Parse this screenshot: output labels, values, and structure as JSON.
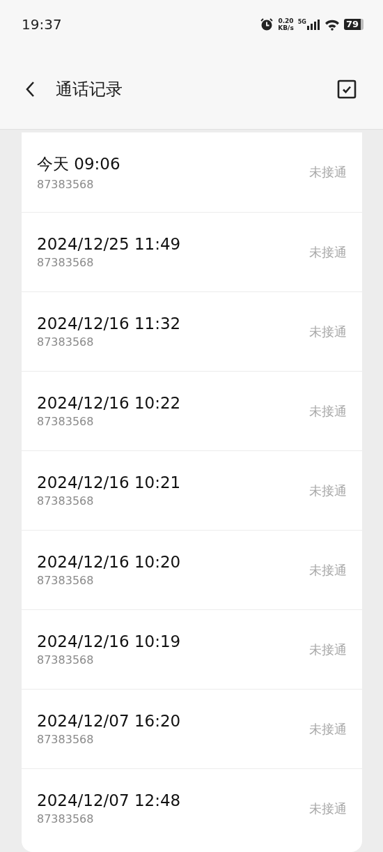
{
  "status_bar": {
    "time": "19:37",
    "speed_value": "0.20",
    "speed_unit": "KB/s",
    "network": "5G",
    "battery": "79"
  },
  "header": {
    "title": "通话记录"
  },
  "calls": [
    {
      "time": "今天 09:06",
      "number": "87383568",
      "status": "未接通"
    },
    {
      "time": "2024/12/25 11:49",
      "number": "87383568",
      "status": "未接通"
    },
    {
      "time": "2024/12/16 11:32",
      "number": "87383568",
      "status": "未接通"
    },
    {
      "time": "2024/12/16 10:22",
      "number": "87383568",
      "status": "未接通"
    },
    {
      "time": "2024/12/16 10:21",
      "number": "87383568",
      "status": "未接通"
    },
    {
      "time": "2024/12/16 10:20",
      "number": "87383568",
      "status": "未接通"
    },
    {
      "time": "2024/12/16 10:19",
      "number": "87383568",
      "status": "未接通"
    },
    {
      "time": "2024/12/07 16:20",
      "number": "87383568",
      "status": "未接通"
    },
    {
      "time": "2024/12/07 12:48",
      "number": "87383568",
      "status": "未接通"
    }
  ]
}
